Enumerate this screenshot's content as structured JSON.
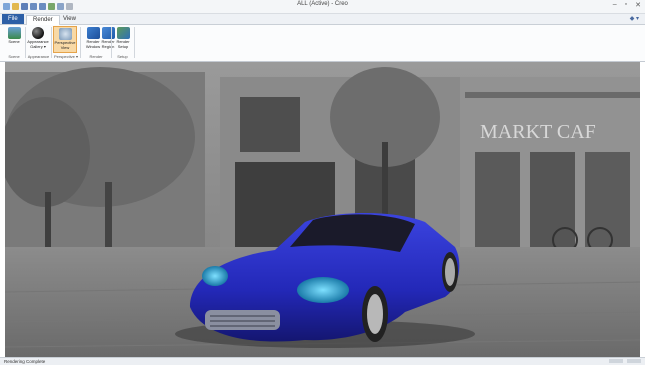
{
  "window": {
    "title": "ALL (Active) - Creo",
    "controls": [
      "–",
      "▫",
      "✕"
    ]
  },
  "quick_access": [
    "new",
    "open",
    "save",
    "undo",
    "redo",
    "regenerate",
    "windows",
    "close"
  ],
  "tabs": [
    {
      "id": "file",
      "label": "File"
    },
    {
      "id": "render",
      "label": "Render"
    },
    {
      "id": "view",
      "label": "View"
    }
  ],
  "ribbon": {
    "buttons": [
      {
        "id": "scene",
        "label": "Scene",
        "icon": "scene-icon"
      },
      {
        "id": "appearance",
        "label": "Appearance Gallery ▾",
        "icon": "appearance-sphere-icon"
      },
      {
        "id": "perspective",
        "label": "Perspective View",
        "icon": "perspective-view-icon"
      },
      {
        "id": "render-window",
        "label": "Render Window",
        "icon": "render-window-icon"
      },
      {
        "id": "render-region",
        "label": "Render Region",
        "icon": "render-region-icon"
      },
      {
        "id": "render-setup",
        "label": "Render Setup",
        "icon": "render-setup-icon"
      }
    ],
    "groups": [
      {
        "id": "g-scene",
        "label": "Scene"
      },
      {
        "id": "g-appearance",
        "label": "Appearance"
      },
      {
        "id": "g-perspective",
        "label": "Perspective ▾"
      },
      {
        "id": "g-render",
        "label": "Render"
      },
      {
        "id": "g-setup",
        "label": "Setup"
      }
    ]
  },
  "viewport": {
    "sign_text": "MARKT CAF",
    "car_color": "#2b2fc8"
  },
  "status": {
    "text": "Rendering Complete"
  },
  "colors": {
    "file_tab": "#2d5fa6",
    "active_button": "#f8d9a6"
  }
}
